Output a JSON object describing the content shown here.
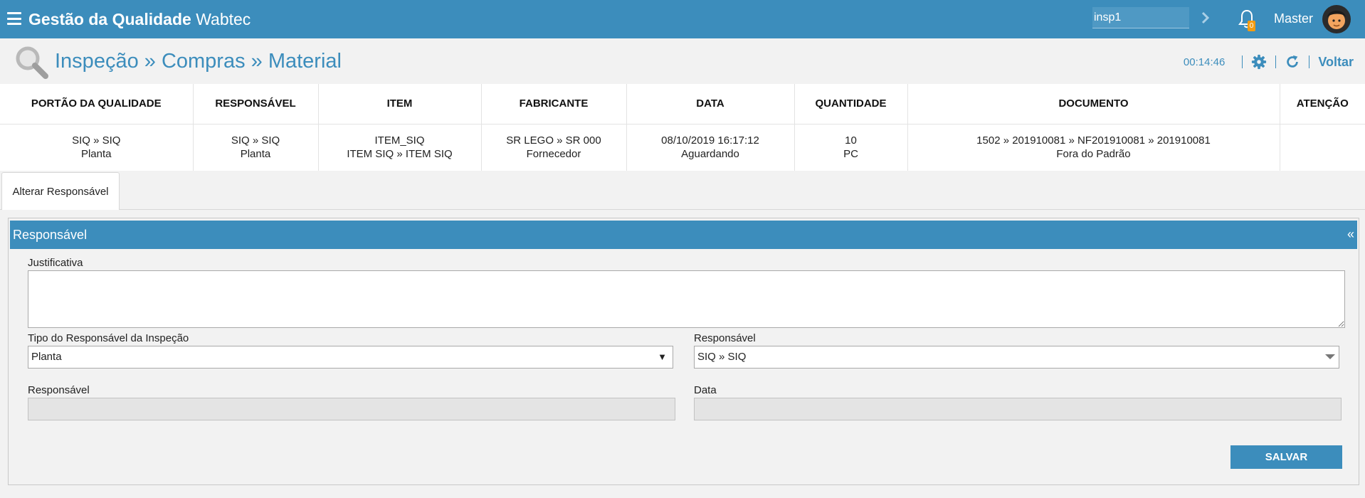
{
  "app": {
    "brand_bold": "Gestão da Qualidade",
    "brand_rest": "Wabtec",
    "search_value": "insp1",
    "notification_count": "0",
    "user_name": "Master"
  },
  "header": {
    "title": "Inspeção » Compras » Material",
    "timer": "00:14:46",
    "back_label": "Voltar"
  },
  "info_table": {
    "columns": [
      "PORTÃO DA QUALIDADE",
      "RESPONSÁVEL",
      "ITEM",
      "FABRICANTE",
      "DATA",
      "QUANTIDADE",
      "DOCUMENTO",
      "ATENÇÃO"
    ],
    "row": [
      {
        "line1": "SIQ » SIQ",
        "line2": "Planta"
      },
      {
        "line1": "SIQ » SIQ",
        "line2": "Planta"
      },
      {
        "line1": "ITEM_SIQ",
        "line2": "ITEM SIQ » ITEM SIQ"
      },
      {
        "line1": "SR LEGO » SR 000",
        "line2": "Fornecedor"
      },
      {
        "line1": "08/10/2019 16:17:12",
        "line2": "Aguardando"
      },
      {
        "line1": "10",
        "line2": "PC"
      },
      {
        "line1": "1502 » 201910081 » NF201910081 » 201910081",
        "line2": "Fora do Padrão"
      },
      {
        "line1": "",
        "line2": ""
      }
    ]
  },
  "tabs": [
    {
      "label": "Alterar Responsável"
    }
  ],
  "panel": {
    "title": "Responsável",
    "collapse_label": "«",
    "justificativa_label": "Justificativa",
    "justificativa_value": "",
    "tipo_label": "Tipo do Responsável da Inspeção",
    "tipo_value": "Planta",
    "responsavel_select_label": "Responsável",
    "responsavel_select_value": "SIQ » SIQ",
    "responsavel_label": "Responsável",
    "data_label": "Data",
    "save_label": "SALVAR"
  },
  "colors": {
    "primary": "#3c8dbc",
    "badge": "#f39c12"
  },
  "icons": {
    "menu": "menu-icon",
    "search_go": "chevron-right-icon",
    "notifications": "bell-icon",
    "page": "magnifier-icon",
    "settings": "gear-icon",
    "refresh": "refresh-icon"
  }
}
